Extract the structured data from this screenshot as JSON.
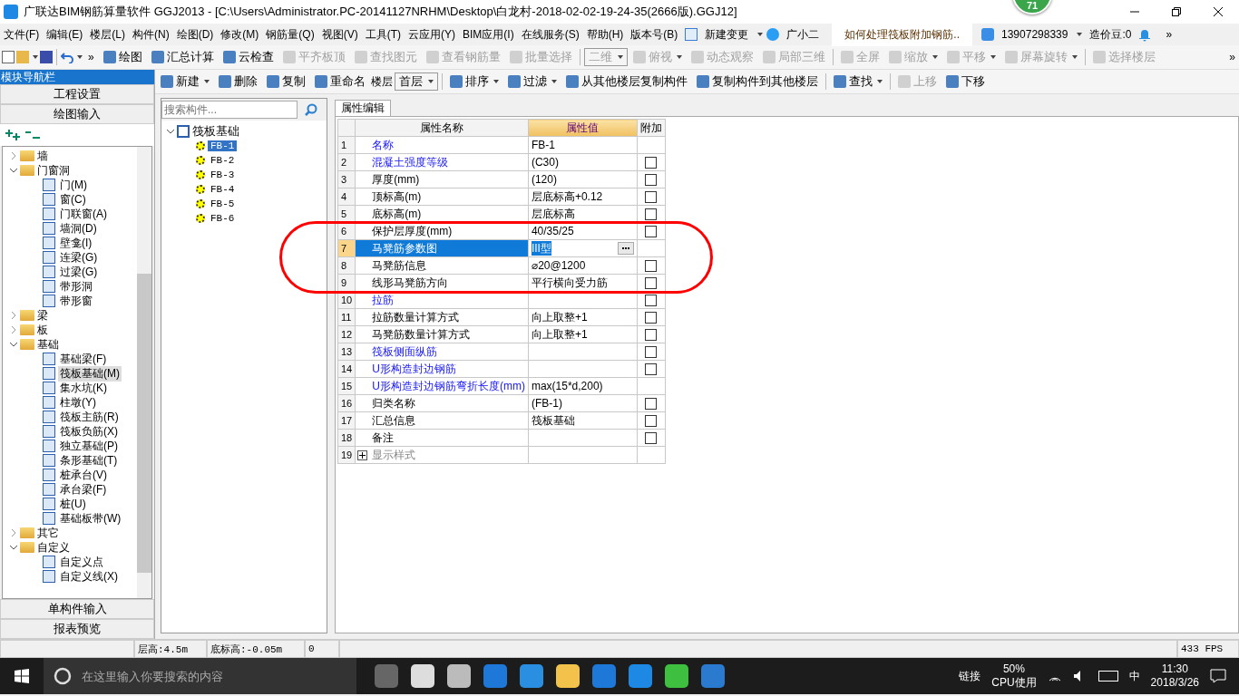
{
  "window": {
    "title": "广联达BIM钢筋算量软件 GGJ2013 - [C:\\Users\\Administrator.PC-20141127NRHM\\Desktop\\白龙村-2018-02-02-19-24-35(2666版).GGJ12]",
    "badge": "71"
  },
  "menu_bar": {
    "items": [
      "文件(F)",
      "编辑(E)",
      "楼层(L)",
      "构件(N)",
      "绘图(D)",
      "修改(M)",
      "钢筋量(Q)",
      "视图(V)",
      "工具(T)",
      "云应用(Y)",
      "BIM应用(I)",
      "在线服务(S)",
      "帮助(H)",
      "版本号(B)"
    ],
    "new_change": "新建变更",
    "assistant": "广小二",
    "question": "如何处理筏板附加钢筋..",
    "account": "13907298339",
    "beans": "造价豆:0",
    "overflow": "»"
  },
  "toolbar": {
    "lead_overflow": "»",
    "items": [
      {
        "kind": "button",
        "label": "绘图",
        "disabled": false,
        "dropdown": false
      },
      {
        "kind": "button",
        "label": "汇总计算",
        "disabled": false,
        "dropdown": false
      },
      {
        "kind": "button",
        "label": "云检查",
        "disabled": false,
        "dropdown": false
      },
      {
        "kind": "button",
        "label": "平齐板顶",
        "disabled": true,
        "dropdown": false
      },
      {
        "kind": "button",
        "label": "查找图元",
        "disabled": true,
        "dropdown": false
      },
      {
        "kind": "button",
        "label": "查看钢筋量",
        "disabled": true,
        "dropdown": false
      },
      {
        "kind": "button",
        "label": "批量选择",
        "disabled": true,
        "dropdown": false
      },
      {
        "kind": "separator"
      },
      {
        "kind": "select",
        "label": "二维",
        "disabled": true,
        "dropdown": true
      },
      {
        "kind": "button",
        "label": "俯视",
        "disabled": true,
        "dropdown": true
      },
      {
        "kind": "button",
        "label": "动态观察",
        "disabled": true,
        "dropdown": false
      },
      {
        "kind": "button",
        "label": "局部三维",
        "disabled": true,
        "dropdown": false
      },
      {
        "kind": "separator"
      },
      {
        "kind": "button",
        "label": "全屏",
        "disabled": true,
        "dropdown": false
      },
      {
        "kind": "button",
        "label": "缩放",
        "disabled": true,
        "dropdown": true
      },
      {
        "kind": "button",
        "label": "平移",
        "disabled": true,
        "dropdown": true
      },
      {
        "kind": "button",
        "label": "屏幕旋转",
        "disabled": true,
        "dropdown": true
      },
      {
        "kind": "separator"
      },
      {
        "kind": "button",
        "label": "选择楼层",
        "disabled": true,
        "dropdown": false
      }
    ],
    "overflow": "»"
  },
  "nav": {
    "title": "模块导航栏",
    "sections_top": [
      "工程设置",
      "绘图输入"
    ],
    "tree": [
      {
        "label": "墙",
        "expanded": false
      },
      {
        "label": "门窗洞",
        "expanded": true,
        "children": [
          {
            "label": "门(M)",
            "selected": false
          },
          {
            "label": "窗(C)",
            "selected": false
          },
          {
            "label": "门联窗(A)",
            "selected": false
          },
          {
            "label": "墙洞(D)",
            "selected": false
          },
          {
            "label": "壁龛(I)",
            "selected": false
          },
          {
            "label": "连梁(G)",
            "selected": false
          },
          {
            "label": "过梁(G)",
            "selected": false
          },
          {
            "label": "带形洞",
            "selected": false
          },
          {
            "label": "带形窗",
            "selected": false
          }
        ]
      },
      {
        "label": "梁",
        "expanded": false
      },
      {
        "label": "板",
        "expanded": false
      },
      {
        "label": "基础",
        "expanded": true,
        "children": [
          {
            "label": "基础梁(F)",
            "selected": false
          },
          {
            "label": "筏板基础(M)",
            "selected": true
          },
          {
            "label": "集水坑(K)",
            "selected": false
          },
          {
            "label": "柱墩(Y)",
            "selected": false
          },
          {
            "label": "筏板主筋(R)",
            "selected": false
          },
          {
            "label": "筏板负筋(X)",
            "selected": false
          },
          {
            "label": "独立基础(P)",
            "selected": false
          },
          {
            "label": "条形基础(T)",
            "selected": false
          },
          {
            "label": "桩承台(V)",
            "selected": false
          },
          {
            "label": "承台梁(F)",
            "selected": false
          },
          {
            "label": "桩(U)",
            "selected": false
          },
          {
            "label": "基础板带(W)",
            "selected": false
          }
        ]
      },
      {
        "label": "其它",
        "expanded": false
      },
      {
        "label": "自定义",
        "expanded": true,
        "children": [
          {
            "label": "自定义点",
            "selected": false
          },
          {
            "label": "自定义线(X)",
            "selected": false
          }
        ]
      }
    ],
    "sections_bottom": [
      "单构件输入",
      "报表预览"
    ]
  },
  "component_toolbar": {
    "items": [
      {
        "kind": "button",
        "label": "新建",
        "disabled": false,
        "dropdown": true
      },
      {
        "kind": "button",
        "label": "删除",
        "disabled": false,
        "dropdown": false
      },
      {
        "kind": "button",
        "label": "复制",
        "disabled": false,
        "dropdown": false
      },
      {
        "kind": "button",
        "label": "重命名",
        "disabled": false,
        "dropdown": false
      },
      {
        "kind": "label",
        "label": "楼层"
      },
      {
        "kind": "select",
        "label": "首层",
        "disabled": false,
        "dropdown": true
      },
      {
        "kind": "separator"
      },
      {
        "kind": "button",
        "label": "排序",
        "disabled": false,
        "dropdown": true
      },
      {
        "kind": "button",
        "label": "过滤",
        "disabled": false,
        "dropdown": true
      },
      {
        "kind": "button",
        "label": "从其他楼层复制构件",
        "disabled": false,
        "dropdown": false
      },
      {
        "kind": "button",
        "label": "复制构件到其他楼层",
        "disabled": false,
        "dropdown": false
      },
      {
        "kind": "separator"
      },
      {
        "kind": "button",
        "label": "查找",
        "disabled": false,
        "dropdown": true
      },
      {
        "kind": "separator"
      },
      {
        "kind": "button",
        "label": "上移",
        "disabled": true,
        "dropdown": false
      },
      {
        "kind": "button",
        "label": "下移",
        "disabled": false,
        "dropdown": false
      }
    ]
  },
  "component_list": {
    "search": {
      "placeholder": "搜索构件..."
    },
    "tree": {
      "label": "筏板基础",
      "expanded": true,
      "children": [
        {
          "label": "FB-1",
          "selected": true
        },
        {
          "label": "FB-2",
          "selected": false
        },
        {
          "label": "FB-3",
          "selected": false
        },
        {
          "label": "FB-4",
          "selected": false
        },
        {
          "label": "FB-5",
          "selected": false
        },
        {
          "label": "FB-6",
          "selected": false
        }
      ]
    }
  },
  "properties": {
    "tab": {
      "label": "属性编辑",
      "selected": true
    },
    "columns": [
      "属性名称",
      "属性值",
      "附加"
    ],
    "rows": [
      {
        "kind": "prop",
        "num": "1",
        "name": "名称",
        "value": "FB-1",
        "link": true,
        "checkbox": false,
        "selected": false
      },
      {
        "kind": "prop",
        "num": "2",
        "name": "混凝土强度等级",
        "value": "(C30)",
        "link": true,
        "checkbox": true,
        "checked": false,
        "selected": false
      },
      {
        "kind": "prop",
        "num": "3",
        "name": "厚度(mm)",
        "value": "(120)",
        "link": false,
        "checkbox": true,
        "checked": false,
        "selected": false
      },
      {
        "kind": "prop",
        "num": "4",
        "name": "顶标高(m)",
        "value": "层底标高+0.12",
        "link": false,
        "checkbox": true,
        "checked": false,
        "selected": false
      },
      {
        "kind": "prop",
        "num": "5",
        "name": "底标高(m)",
        "value": "层底标高",
        "link": false,
        "checkbox": true,
        "checked": false,
        "selected": false
      },
      {
        "kind": "prop",
        "num": "6",
        "name": "保护层厚度(mm)",
        "value": "40/35/25",
        "link": false,
        "checkbox": true,
        "checked": false,
        "selected": false
      },
      {
        "kind": "prop",
        "num": "7",
        "name": "马凳筋参数图",
        "value": "III型",
        "link": false,
        "checkbox": false,
        "selected": true
      },
      {
        "kind": "prop",
        "num": "8",
        "name": "马凳筋信息",
        "value": "⌀20@1200",
        "link": false,
        "checkbox": true,
        "checked": false,
        "selected": false
      },
      {
        "kind": "prop",
        "num": "9",
        "name": "线形马凳筋方向",
        "value": "平行横向受力筋",
        "link": false,
        "checkbox": true,
        "checked": false,
        "selected": false
      },
      {
        "kind": "prop",
        "num": "10",
        "name": "拉筋",
        "link": true,
        "checkbox": true,
        "checked": false,
        "selected": false
      },
      {
        "kind": "prop",
        "num": "11",
        "name": "拉筋数量计算方式",
        "value": "向上取整+1",
        "link": false,
        "checkbox": true,
        "checked": false,
        "selected": false
      },
      {
        "kind": "prop",
        "num": "12",
        "name": "马凳筋数量计算方式",
        "value": "向上取整+1",
        "link": false,
        "checkbox": true,
        "checked": false,
        "selected": false
      },
      {
        "kind": "prop",
        "num": "13",
        "name": "筏板侧面纵筋",
        "link": true,
        "checkbox": true,
        "checked": false,
        "selected": false
      },
      {
        "kind": "prop",
        "num": "14",
        "name": "U形构造封边钢筋",
        "link": true,
        "checkbox": true,
        "checked": false,
        "selected": false
      },
      {
        "kind": "prop",
        "num": "15",
        "name": "U形构造封边钢筋弯折长度(mm)",
        "value": "max(15*d,200)",
        "link": true,
        "checkbox": false,
        "selected": false
      },
      {
        "kind": "prop",
        "num": "16",
        "name": "归类名称",
        "value": "(FB-1)",
        "link": false,
        "checkbox": true,
        "checked": false,
        "selected": false
      },
      {
        "kind": "prop",
        "num": "17",
        "name": "汇总信息",
        "value": "筏板基础",
        "link": false,
        "checkbox": true,
        "checked": false,
        "selected": false
      },
      {
        "kind": "prop",
        "num": "18",
        "name": "备注",
        "link": false,
        "checkbox": true,
        "checked": false,
        "selected": false
      },
      {
        "kind": "group",
        "num": "19",
        "name": "显示样式",
        "expanded": false,
        "selected": false
      }
    ]
  },
  "status_bar": {
    "cells": [
      "层高:4.5m",
      "底标高:-0.05m",
      "0"
    ],
    "fps": "433 FPS"
  },
  "taskbar": {
    "search": {
      "placeholder": "在这里输入你要搜索的内容"
    },
    "link": "链接",
    "cpu": "50%",
    "cpu_label": "CPU使用",
    "ime": "中",
    "time": "11:30",
    "date": "2018/3/26"
  }
}
